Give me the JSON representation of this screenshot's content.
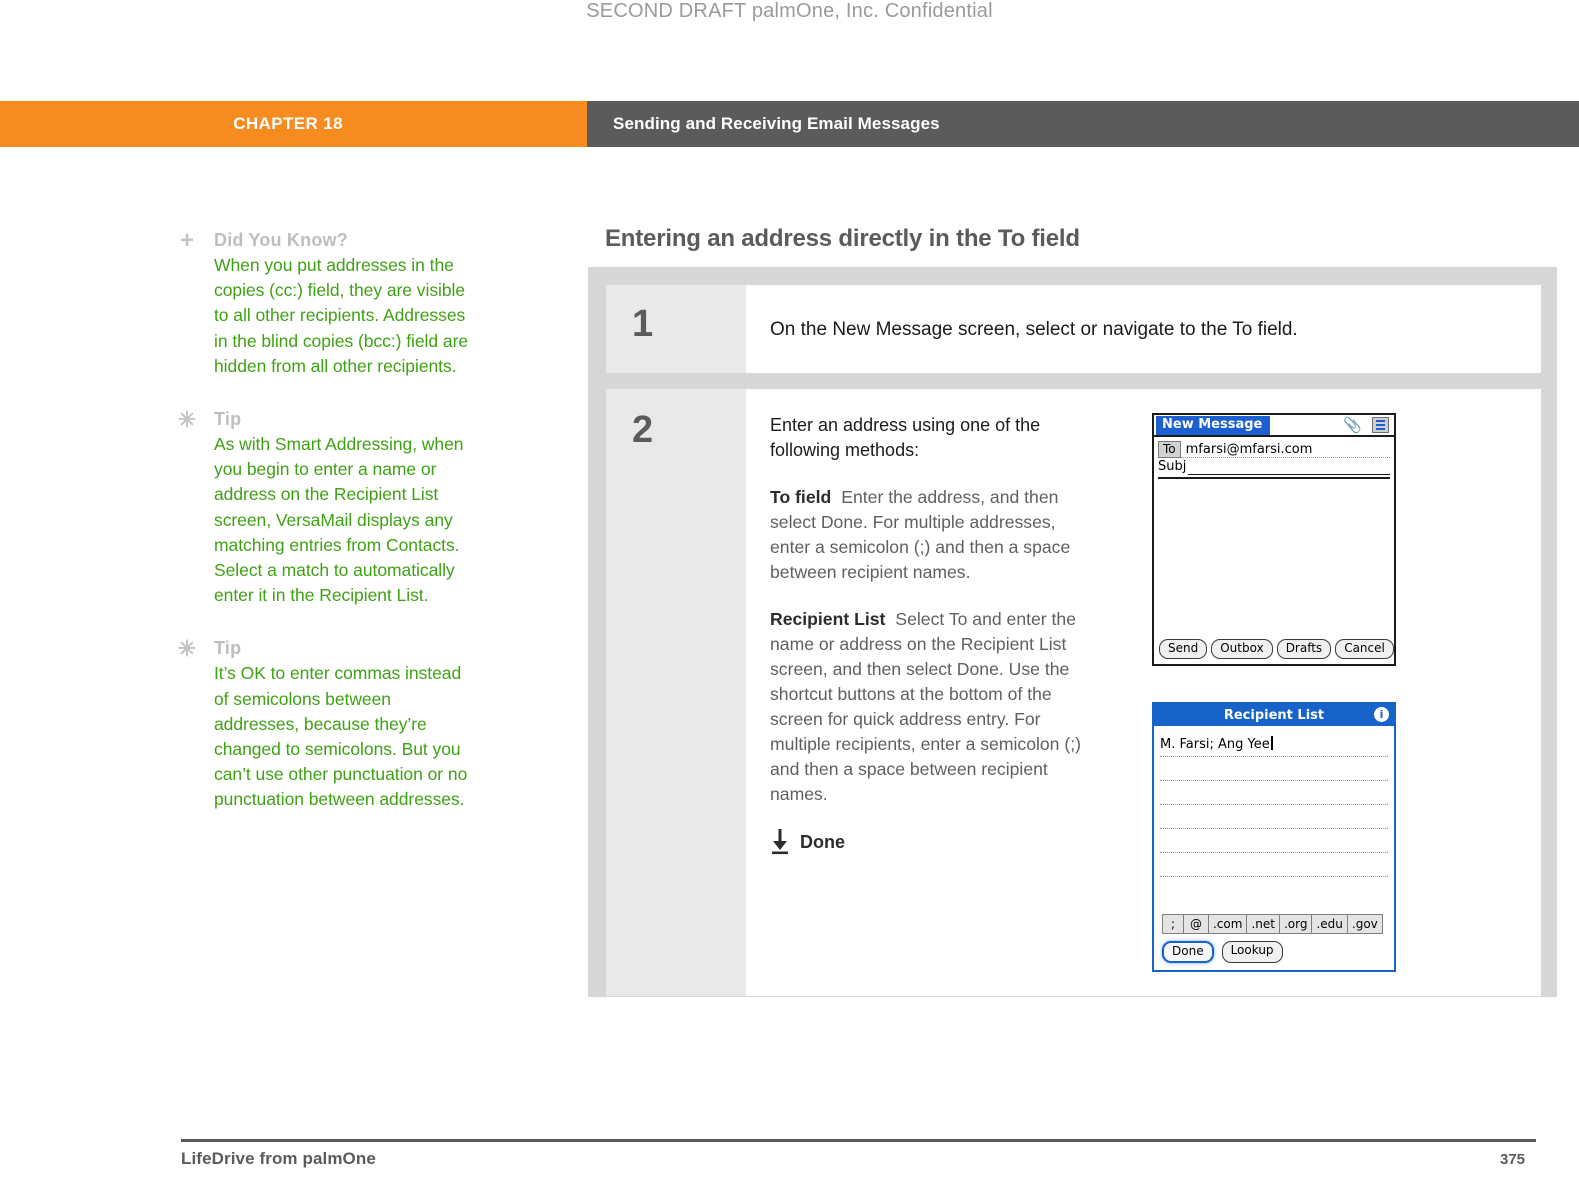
{
  "draft_notice": "SECOND DRAFT palmOne, Inc.  Confidential",
  "header": {
    "chapter_label": "CHAPTER 18",
    "chapter_title": "Sending and Receiving Email Messages",
    "accent_color": "#F68B1F",
    "bar_color": "#5B5B5B"
  },
  "sidebar": {
    "tips": [
      {
        "marker": "plus-icon",
        "marker_glyph": "+",
        "title": "Did You Know?",
        "body": "When you put addresses in the copies (cc:) field, they are visible to all other recipients. Addresses in the blind copies (bcc:) field are hidden from all other recipients."
      },
      {
        "marker": "asterisk-icon",
        "marker_glyph": "✳",
        "title": "Tip",
        "body": "As with Smart Addressing, when you begin to enter a name or address on the Recipient List screen, VersaMail displays any matching entries from Contacts. Select a match to automatically enter it in the Recipient List."
      },
      {
        "marker": "asterisk-icon",
        "marker_glyph": "✳",
        "title": "Tip",
        "body": "It’s OK to enter commas instead of semicolons between addresses, because they’re changed to semicolons. But you can’t use other punctuation or no punctuation between addresses."
      }
    ],
    "tip_text_color": "#3FA214",
    "tip_title_color": "#BEBEBE"
  },
  "main": {
    "section_title": "Entering an address directly in the To field",
    "steps": [
      {
        "number": "1",
        "text": "On the New Message screen, select or navigate to the To field."
      },
      {
        "number": "2",
        "lead": "Enter an address using one of the following methods:",
        "method_to_field_label": "To field",
        "method_to_field_text": "Enter the address, and then select Done. For multiple addresses, enter a semicolon (;) and then a space between recipient names.",
        "method_recipient_list_label": "Recipient List",
        "method_recipient_list_text": "Select To and enter the name or address on the Recipient List screen, and then select Done. Use the shortcut buttons at the bottom of the screen for quick address entry. For multiple recipients, enter a semicolon (;) and then a space between recipient names.",
        "done_label": "Done",
        "done_icon": "down-arrow-icon"
      }
    ]
  },
  "figures": {
    "new_message": {
      "title": "New Message",
      "attachment_icon": "paperclip-icon",
      "menu_icon": "menu-icon",
      "to_button_label": "To",
      "to_value": "mfarsi@mfarsi.com",
      "subject_label": "Subj",
      "subject_value": "",
      "buttons": [
        "Send",
        "Outbox",
        "Drafts",
        "Cancel"
      ]
    },
    "recipient_list": {
      "title": "Recipient List",
      "info_icon": "info-icon",
      "entry_value": "M. Farsi; Ang Yee",
      "empty_lines": 6,
      "shortcuts": [
        ";",
        "@",
        ".com",
        ".net",
        ".org",
        ".edu",
        ".gov"
      ],
      "buttons": [
        "Done",
        "Lookup"
      ],
      "primary_button": "Done"
    }
  },
  "footer": {
    "left": "LifeDrive from palmOne",
    "page_number": "375"
  }
}
